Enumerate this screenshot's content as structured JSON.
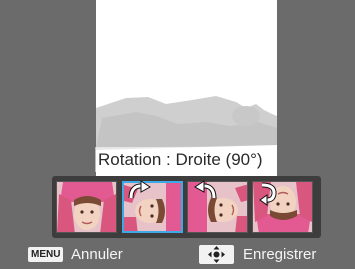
{
  "preview": {
    "caption": "Rotation : Droite (90°)"
  },
  "thumbnails": [
    {
      "name": "original",
      "selected": false
    },
    {
      "name": "rotate-right-90",
      "selected": true
    },
    {
      "name": "rotate-left-90",
      "selected": false
    },
    {
      "name": "rotate-180",
      "selected": false
    }
  ],
  "footer": {
    "menu_key": "MENU",
    "cancel_label": "Annuler",
    "dpad_icon": "dpad-icon",
    "save_label": "Enregistrer"
  },
  "colors": {
    "background": "#6b6b6b",
    "selection": "#3fa9e8",
    "strip": "#3d3d3d"
  }
}
